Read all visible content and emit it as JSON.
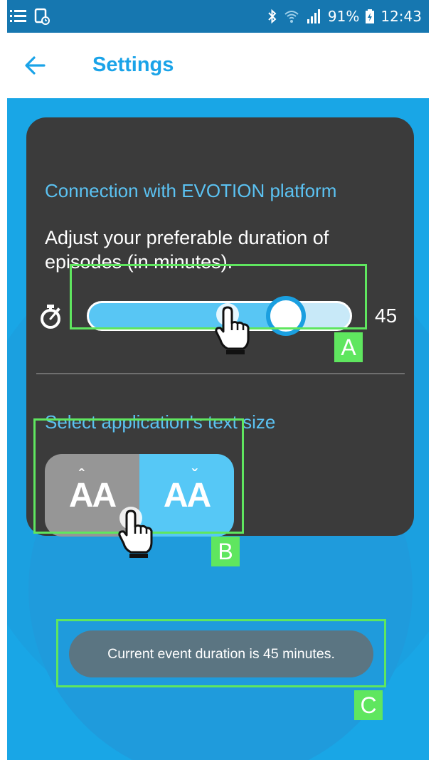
{
  "status_bar": {
    "left_icons": [
      "notification-list-icon",
      "screenshot-icon"
    ],
    "right_icons": [
      "bluetooth-icon",
      "wifi-icon",
      "signal-icon",
      "battery-charging-icon"
    ],
    "battery": "91%",
    "time": "12:43"
  },
  "app_bar": {
    "back_icon": "arrow-left-icon",
    "title": "Settings"
  },
  "card": {
    "connection_title": "Connection with EVOTION platform",
    "duration_prompt": "Adjust your preferable duration of episodes (in minutes).",
    "duration_slider": {
      "icon": "stopwatch-icon",
      "value": "45",
      "fill_fraction": 0.75
    },
    "text_size_title": "Select application's text size",
    "text_size_options": [
      {
        "label": "AA",
        "accent": "^",
        "selected": false
      },
      {
        "label": "AA",
        "accent": "v",
        "selected": true
      }
    ]
  },
  "annotations": {
    "a": "A",
    "b": "B",
    "c": "C"
  },
  "toast": {
    "message": "Current event duration is 45 minutes."
  },
  "colors": {
    "status_bar": "#1677b0",
    "accent": "#1aa3e8",
    "background": "#19a6e6",
    "card": "#3b3b3b",
    "highlight": "#5fe65f",
    "toast": "#5b7582"
  }
}
